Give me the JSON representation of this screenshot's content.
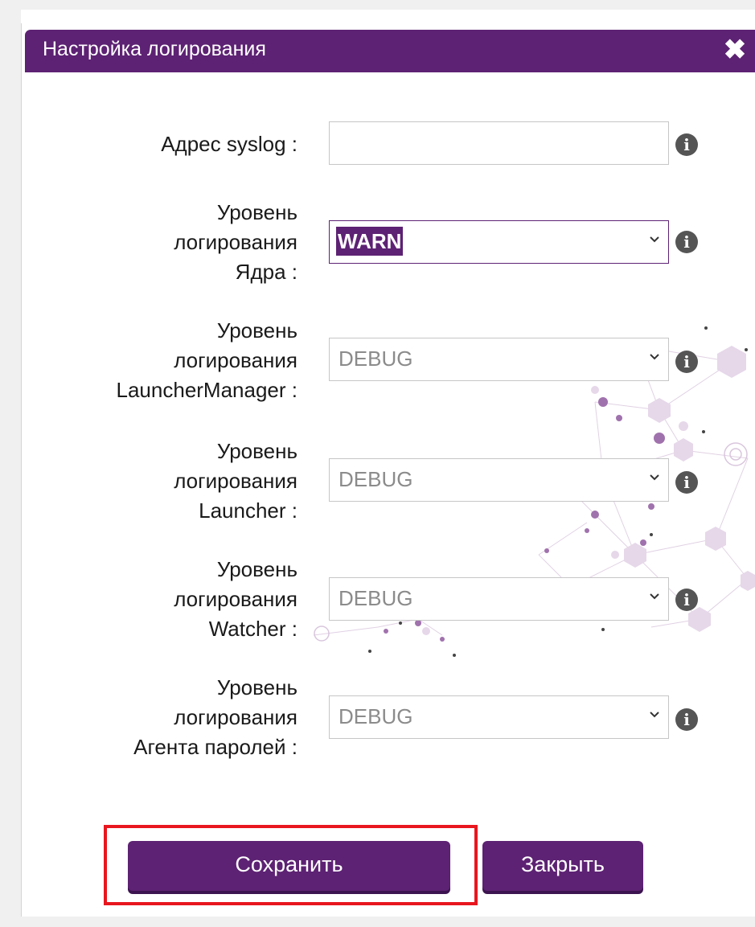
{
  "dialog": {
    "title": "Настройка логирования",
    "close_icon": "close-icon",
    "accent_color": "#5d2273"
  },
  "fields": [
    {
      "label": "Адрес syslog :",
      "type": "text",
      "value": ""
    },
    {
      "label": "Уровень логирования Ядра :",
      "label_lines": [
        "Уровень",
        "логирования",
        "Ядра :"
      ],
      "type": "select",
      "value": "WARN",
      "focused": true
    },
    {
      "label": "Уровень логирования LauncherManager :",
      "label_lines": [
        "Уровень",
        "логирования",
        "LauncherManager :"
      ],
      "type": "select",
      "value": "DEBUG"
    },
    {
      "label": "Уровень логирования Launcher :",
      "label_lines": [
        "Уровень",
        "логирования",
        "Launcher :"
      ],
      "type": "select",
      "value": "DEBUG"
    },
    {
      "label": "Уровень логирования Watcher :",
      "label_lines": [
        "Уровень",
        "логирования",
        "Watcher :"
      ],
      "type": "select",
      "value": "DEBUG"
    },
    {
      "label": "Уровень логирования Агента паролей :",
      "label_lines": [
        "Уровень",
        "логирования",
        "Агента паролей :"
      ],
      "type": "select",
      "value": "DEBUG"
    }
  ],
  "info_icon": "i",
  "buttons": {
    "save": "Сохранить",
    "close": "Закрыть"
  },
  "highlight_color": "#e8161e"
}
